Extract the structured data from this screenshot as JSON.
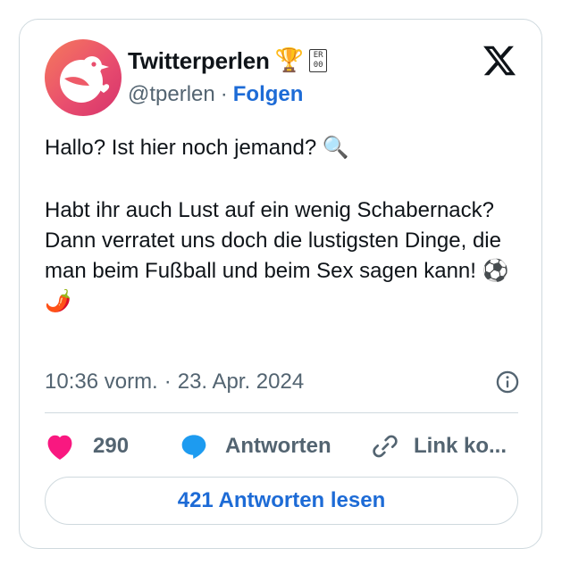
{
  "author": {
    "display_name": "Twitterperlen",
    "trophy_emoji": "🏆",
    "badge_text": "ER\n00",
    "handle": "@tperlen",
    "separator": "·",
    "follow_label": "Folgen",
    "avatar_icon": "bird-icon",
    "avatar_colors": [
      "#f57a5c",
      "#d6336c"
    ]
  },
  "platform_icon": "x-logo-icon",
  "tweet": {
    "line1": "Hallo? Ist hier noch jemand? 🔍",
    "line2": "Habt ihr auch Lust auf ein wenig Schabernack?",
    "line3": "Dann verratet uns doch die lustigsten Dinge, die man beim Fußball und beim Sex sagen kann! ⚽🌶️"
  },
  "meta": {
    "time": "10:36 vorm.",
    "separator": "·",
    "date": "23. Apr. 2024",
    "info_icon": "info-icon"
  },
  "actions": {
    "like_count": "290",
    "reply_label": "Antworten",
    "link_label": "Link ko..."
  },
  "read_replies_label": "421 Antworten lesen",
  "colors": {
    "accent": "#1d6bd6",
    "like": "#f91880",
    "reply_icon": "#1d9bf0",
    "muted": "#536471",
    "border": "#cfd9de"
  }
}
